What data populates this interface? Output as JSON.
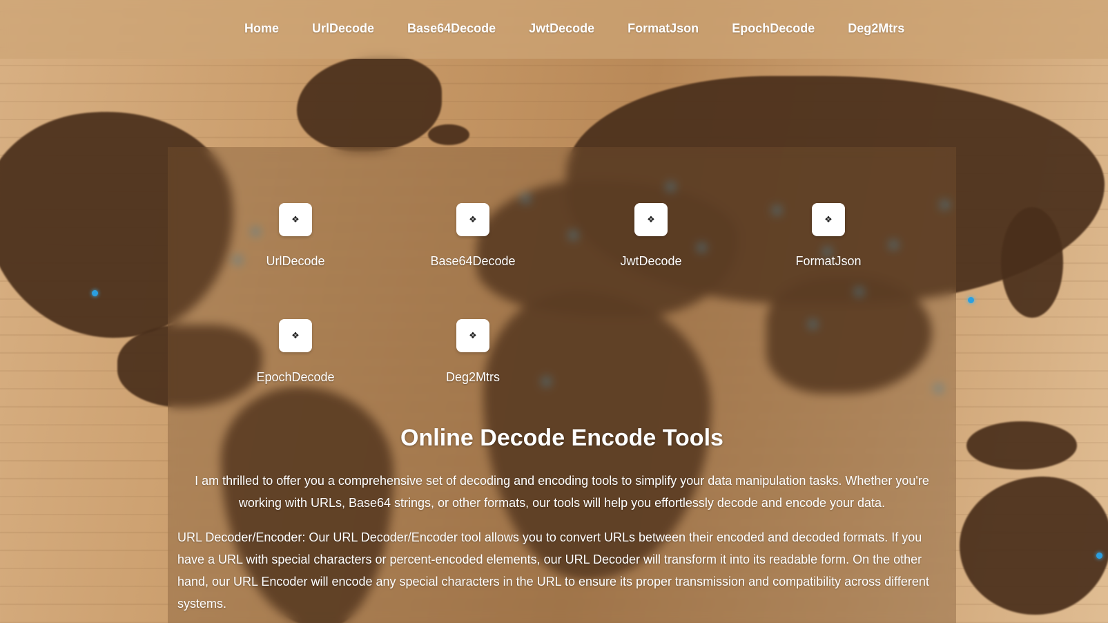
{
  "nav": {
    "items": [
      {
        "label": "Home"
      },
      {
        "label": "UrlDecode"
      },
      {
        "label": "Base64Decode"
      },
      {
        "label": "JwtDecode"
      },
      {
        "label": "FormatJson"
      },
      {
        "label": "EpochDecode"
      },
      {
        "label": "Deg2Mtrs"
      }
    ]
  },
  "tools": {
    "icon_glyph": "❖",
    "icon_name": "diamond-tile-icon",
    "items": [
      {
        "label": "UrlDecode"
      },
      {
        "label": "Base64Decode"
      },
      {
        "label": "JwtDecode"
      },
      {
        "label": "FormatJson"
      },
      {
        "label": "EpochDecode"
      },
      {
        "label": "Deg2Mtrs"
      }
    ]
  },
  "main": {
    "title": "Online Decode Encode Tools",
    "intro": "I am thrilled to offer you a comprehensive set of decoding and encoding tools to simplify your data manipulation tasks. Whether you're working with URLs, Base64 strings, or other formats, our tools will help you effortlessly decode and encode your data.",
    "description": "URL Decoder/Encoder: Our URL Decoder/Encoder tool allows you to convert URLs between their encoded and decoded formats. If you have a URL with special characters or percent-encoded elements, our URL Decoder will transform it into its readable form. On the other hand, our URL Encoder will encode any special characters in the URL to ensure its proper transmission and compatibility across different systems."
  },
  "colors": {
    "accent_dot": "#2b9fe0",
    "tile_bg": "#ffffff",
    "text": "#ffffff"
  }
}
